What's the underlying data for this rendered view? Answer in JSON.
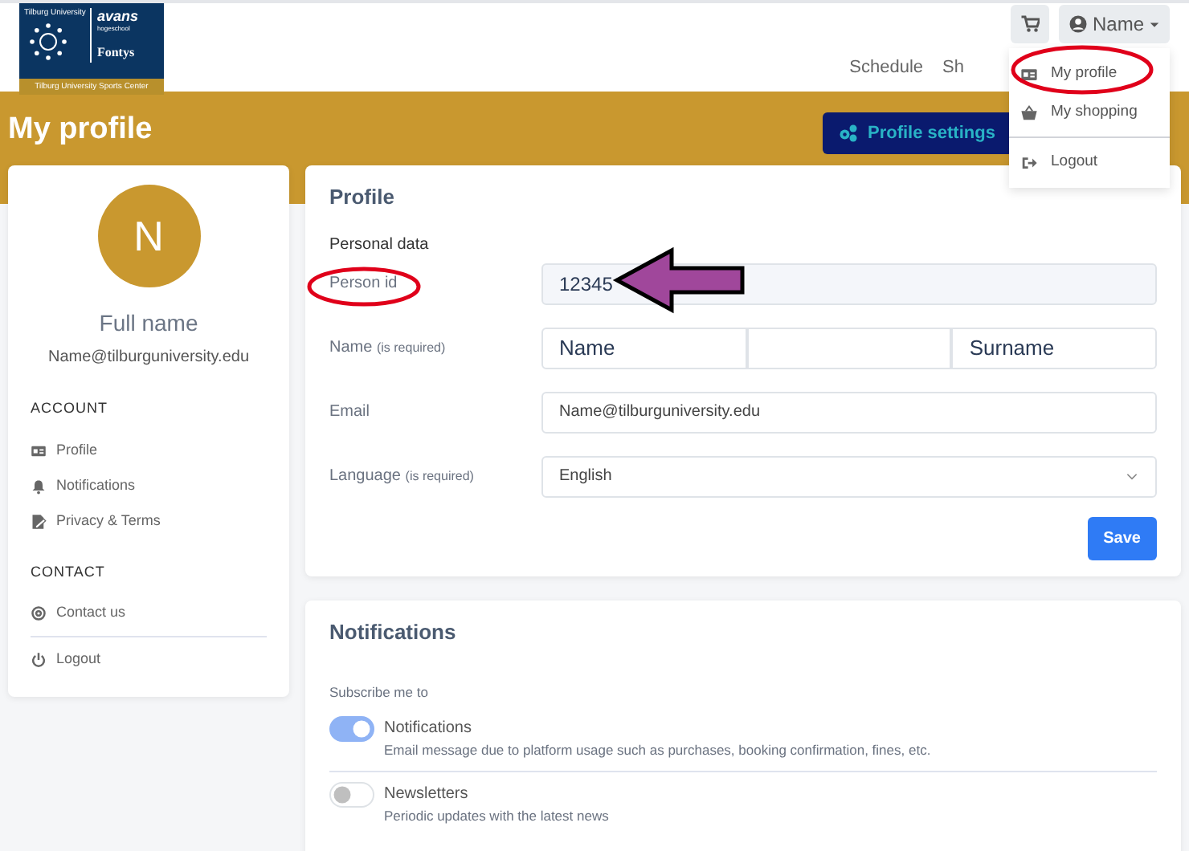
{
  "logo": {
    "university": "Tilburg University",
    "brand_1": "avans",
    "brand_1_sub": "hogeschool",
    "brand_2": "Fontys",
    "caption": "Tilburg University Sports Center"
  },
  "header": {
    "user_button": "Name",
    "nav": [
      {
        "label": "Schedule"
      },
      {
        "label": "Sh"
      }
    ]
  },
  "user_menu": {
    "items": [
      {
        "label": "My profile",
        "kind": "id-card"
      },
      {
        "label": "My shopping",
        "kind": "basket"
      },
      {
        "label": "Logout",
        "kind": "logout"
      }
    ]
  },
  "page_title": "My profile",
  "settings_button": "Profile settings",
  "sidebar": {
    "avatar_letter": "N",
    "full_name": "Full name",
    "email": "Name@tilburguniversity.edu",
    "sections": [
      {
        "heading": "ACCOUNT",
        "items": [
          {
            "label": "Profile",
            "kind": "id-card"
          },
          {
            "label": "Notifications",
            "kind": "bell"
          },
          {
            "label": "Privacy & Terms",
            "kind": "document"
          }
        ]
      },
      {
        "heading": "CONTACT",
        "items": [
          {
            "label": "Contact us",
            "kind": "at"
          }
        ]
      }
    ],
    "logout": "Logout"
  },
  "profile": {
    "title": "Profile",
    "section": "Personal data",
    "person_id": {
      "label": "Person id",
      "value": "12345"
    },
    "name": {
      "label": "Name",
      "note": "(is required)",
      "first": "Name",
      "last": "Surname"
    },
    "email": {
      "label": "Email",
      "value": "Name@tilburguniversity.edu"
    },
    "language": {
      "label": "Language",
      "note": "(is required)",
      "value": "English"
    },
    "save": "Save"
  },
  "notifications": {
    "title": "Notifications",
    "subtitle": "Subscribe me to",
    "items": [
      {
        "label": "Notifications",
        "description": "Email message due to platform usage such as purchases, booking confirmation, fines, etc.",
        "on": true
      },
      {
        "label": "Newsletters",
        "description": "Periodic updates with the latest news",
        "on": false
      }
    ]
  }
}
